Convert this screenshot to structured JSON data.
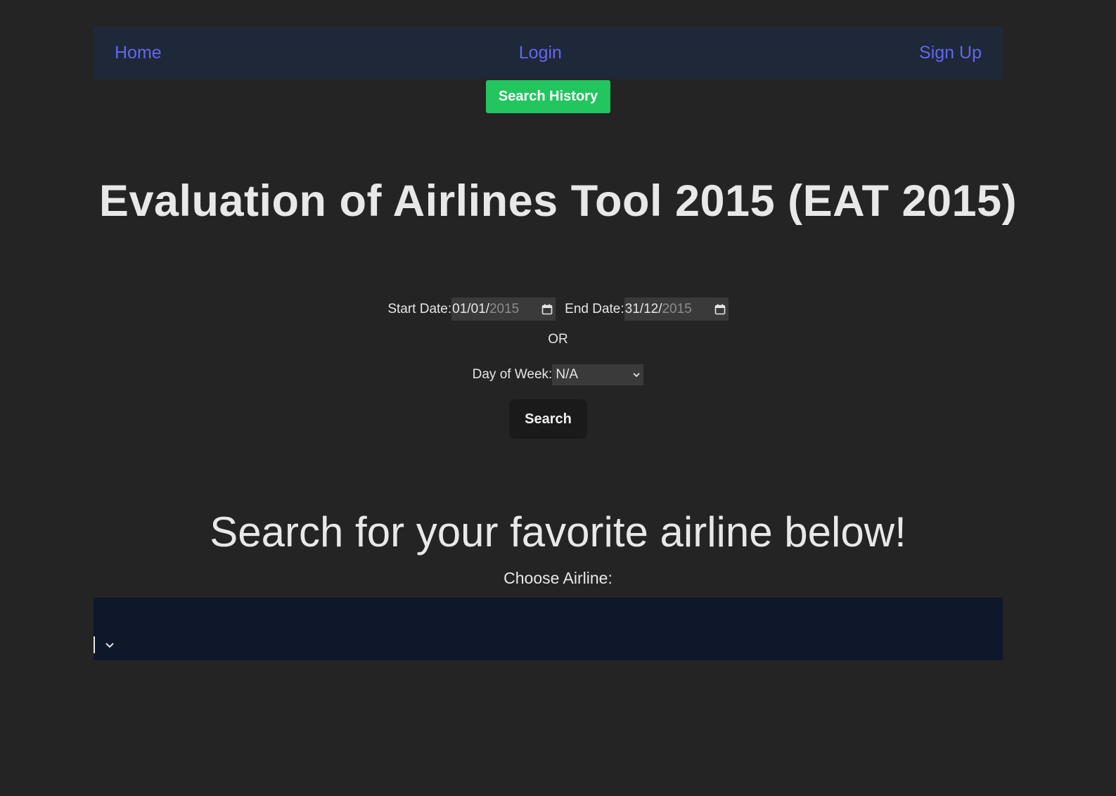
{
  "nav": {
    "home_label": "Home",
    "login_label": "Login",
    "signup_label": "Sign Up"
  },
  "history_button": {
    "label": "Search History"
  },
  "title": "Evaluation of Airlines Tool 2015 (EAT 2015)",
  "date_filter": {
    "start_label": "Start Date:",
    "start_value_bright": "01/01/",
    "start_value_dim": "2015",
    "end_label": "End Date:",
    "end_value_bright": "31/12/",
    "end_value_dim": "2015"
  },
  "or_text": "OR",
  "day_of_week": {
    "label": "Day of Week:",
    "selected": "N/A"
  },
  "search_button": {
    "label": "Search"
  },
  "airline_section": {
    "heading": "Search for your favorite airline below!",
    "choose_label": "Choose Airline:",
    "selected": ""
  },
  "colors": {
    "background": "#242424",
    "navbar": "#1e2838",
    "nav_link": "#6366f1",
    "history_button": "#22c55e",
    "airline_select": "#0f172a"
  },
  "icons": [
    "calendar-icon",
    "chevron-down-icon"
  ]
}
